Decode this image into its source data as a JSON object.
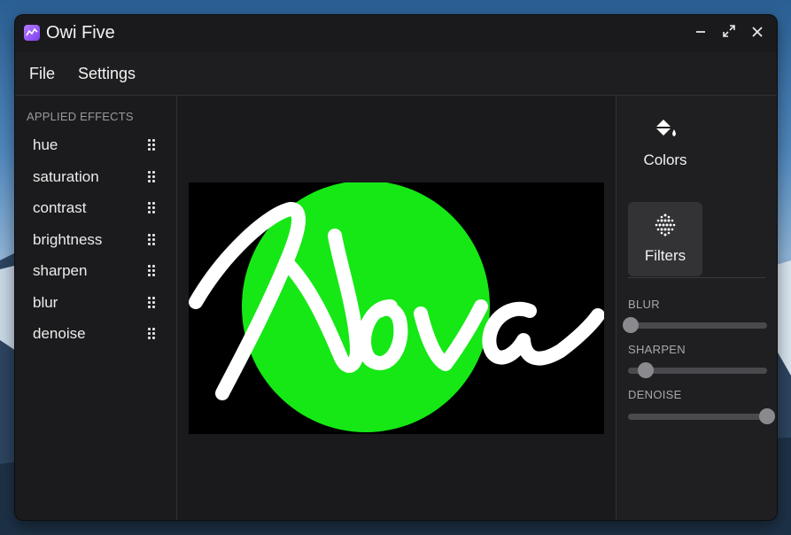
{
  "window": {
    "title": "Owi Five"
  },
  "menu": {
    "file": "File",
    "settings": "Settings"
  },
  "sidebar": {
    "header": "APPLIED EFFECTS",
    "effects": [
      "hue",
      "saturation",
      "contrast",
      "brightness",
      "sharpen",
      "blur",
      "denoise"
    ]
  },
  "preview": {
    "text": "Nova",
    "circle_color": "#15e815",
    "background": "#000000"
  },
  "tools": {
    "colors": "Colors",
    "filters": "Filters",
    "active": "Filters"
  },
  "sliders": [
    {
      "label": "BLUR",
      "value": 0.02
    },
    {
      "label": "SHARPEN",
      "value": 0.13
    },
    {
      "label": "DENOISE",
      "value": 1.0
    }
  ],
  "colors": {
    "window_bg": "#1c1c1e",
    "panel_active": "#333336",
    "text": "#f2f2f2",
    "muted": "#9a9a9e"
  }
}
